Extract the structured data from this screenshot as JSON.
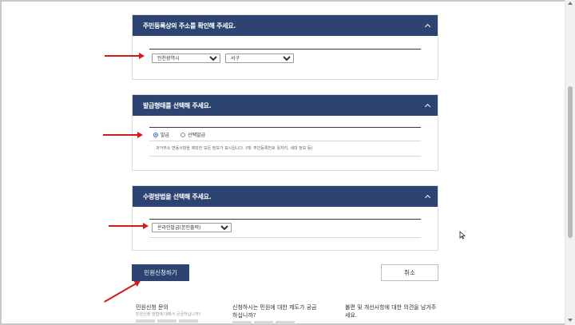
{
  "sections": [
    {
      "title": "주민등록상의 주소를 확인해 주세요.",
      "fields": {
        "city": "인천광역시",
        "district": "서구"
      }
    },
    {
      "title": "발급형태를 선택해 주세요.",
      "options": [
        "발급",
        "선택발급"
      ],
      "selected": "발급",
      "note": "과거주소 변동사항을 제외한 모든 정보가 표시됩니다. (예: 주민등록번호 뒷자리, 세대 정보 등)"
    },
    {
      "title": "수령방법을 선택해 주세요.",
      "fields": {
        "method": "온라인발급(본인출력)"
      }
    }
  ],
  "buttons": {
    "apply": "민원신청하기",
    "cancel": "취소"
  },
  "info": {
    "col1_title": "민원신청 문의",
    "col1_sub": "민원신청 방법에 대해서 궁금하십니까?",
    "col2_title": "신청하시는 민원에 대한 제도가 궁금하십니까?",
    "col3_title": "불편 및 개선사항에 대한 의견을 남겨주세요."
  },
  "icons": {
    "collapse": "chevron-up-icon",
    "cursor": "mouse-cursor-icon"
  },
  "colors": {
    "header": "#2d4472",
    "annotation": "#d31a1a"
  }
}
